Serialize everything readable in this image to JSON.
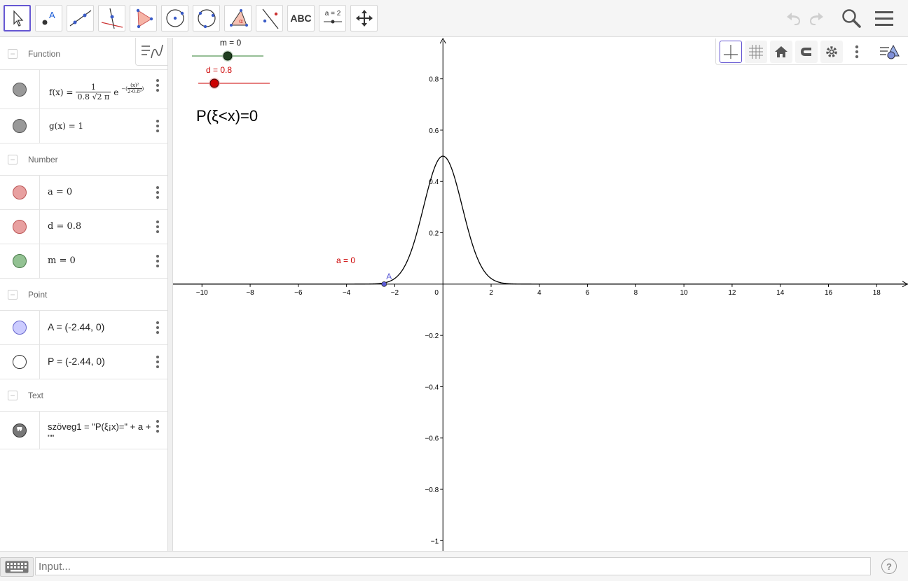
{
  "toolbar": {
    "tools": [
      {
        "name": "move-tool",
        "label": ""
      },
      {
        "name": "point-tool",
        "label": "A"
      },
      {
        "name": "line-tool",
        "label": ""
      },
      {
        "name": "perpendicular-line-tool",
        "label": ""
      },
      {
        "name": "polygon-tool",
        "label": ""
      },
      {
        "name": "circle-center-point-tool",
        "label": ""
      },
      {
        "name": "circle-three-points-tool",
        "label": ""
      },
      {
        "name": "angle-tool",
        "label": ""
      },
      {
        "name": "reflect-tool",
        "label": ""
      },
      {
        "name": "text-tool",
        "label": "ABC"
      },
      {
        "name": "slider-tool",
        "label": "a = 2"
      },
      {
        "name": "move-graphics-view-tool",
        "label": ""
      }
    ]
  },
  "algebra": {
    "groups": [
      {
        "title": "Function"
      },
      {
        "title": "Number"
      },
      {
        "title": "Point"
      },
      {
        "title": "Text"
      }
    ],
    "function_f": {
      "prefix": "f(x) =",
      "numerator": "1",
      "denominator": "0.8 √2 π",
      "exp_base": "e",
      "exponent_num": "(x)²",
      "exponent_den": "2·0.8²"
    },
    "function_g": "g(x) = 1",
    "number_a": "a = 0",
    "number_d": "d = 0.8",
    "number_m": "m = 0",
    "point_A": "A = (-2.44, 0)",
    "point_P": "P = (-2.44, 0)",
    "text_line1": "szöveg1 = \"P(ξ¡x)=\" + a +",
    "text_line2": "\"\""
  },
  "graphics": {
    "slider_m_label": "m = 0",
    "slider_d_label": "d = 0.8",
    "probability_text": "P(ξ<x)=0",
    "label_a": "a = 0",
    "point_label": "A",
    "x_ticks": [
      "−10",
      "−8",
      "−6",
      "−4",
      "−2",
      "0",
      "2",
      "4",
      "6",
      "8",
      "10",
      "12",
      "14",
      "16",
      "18"
    ],
    "y_ticks": [
      "0.8",
      "0.6",
      "0.4",
      "0.2",
      "−0.2",
      "−0.4",
      "−0.6",
      "−0.8",
      "−1"
    ]
  },
  "chart_data": {
    "type": "line",
    "title": "",
    "xlabel": "",
    "ylabel": "",
    "xlim": [
      -11.2,
      19.3
    ],
    "ylim": [
      -1.04,
      0.96
    ],
    "grid": false,
    "series": [
      {
        "name": "f",
        "formula": "1/(0.8*sqrt(2*pi)) * exp(-(x)^2/(2*0.8^2))",
        "mean": 0,
        "sd": 0.8
      }
    ],
    "points": [
      {
        "name": "A",
        "x": -2.44,
        "y": 0
      }
    ],
    "colors": {
      "curve": "#000000",
      "point": "#5b5bd6",
      "slider_m": "#2e6b2e",
      "slider_d": "#cc0000",
      "label_a": "#cc0000"
    }
  },
  "colors": {
    "accent": "#6557d2",
    "marble_function": "#999999",
    "marble_number_red": "#e8a0a0",
    "marble_number_green": "#93c293",
    "marble_point_A": "#ccccff",
    "marble_point_P": "#ffffff",
    "marble_text": "#888888"
  },
  "input": {
    "placeholder": "Input..."
  }
}
